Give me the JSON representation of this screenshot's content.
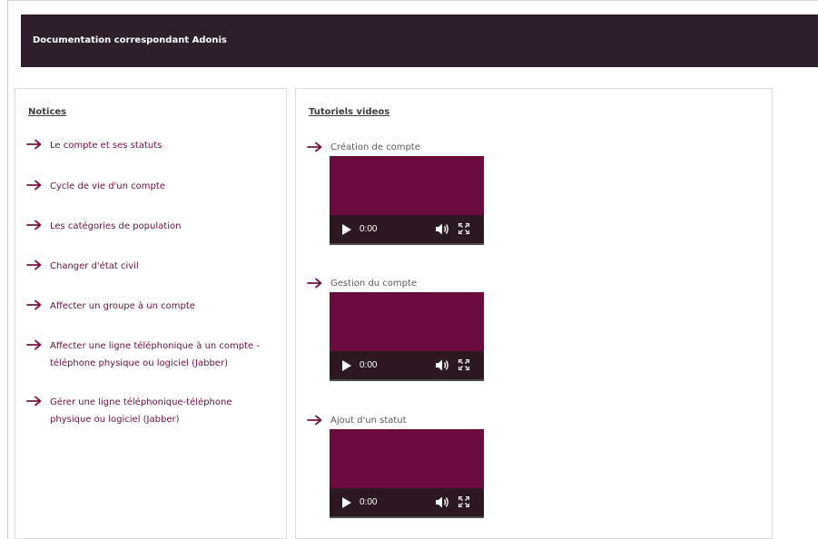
{
  "banner": {
    "title": "Documentation correspondant Adonis"
  },
  "notices": {
    "heading": "Notices",
    "items": [
      {
        "label": "Le compte et ses statuts"
      },
      {
        "label": "Cycle de vie d'un compte"
      },
      {
        "label": "Les catégories de population"
      },
      {
        "label": "Changer d'état civil"
      },
      {
        "label": "Affecter un groupe à un compte"
      },
      {
        "label": "Affecter une ligne téléphonique à un compte -\ntéléphone physique ou logiciel (Jabber)"
      },
      {
        "label": "Gérer une ligne téléphonique-téléphone\nphysique ou logiciel (Jabber)"
      }
    ]
  },
  "videos": {
    "heading": "Tutoriels videos",
    "items": [
      {
        "label": "Création de compte",
        "time": "0:00"
      },
      {
        "label": "Gestion du compte",
        "time": "0:00"
      },
      {
        "label": "Ajout d'un statut",
        "time": "0:00"
      }
    ]
  },
  "colors": {
    "banner_bg": "#2e1f2f",
    "link": "#6b0f3f",
    "video_bg": "#6b0a3c",
    "controls_bg": "#2b1820"
  },
  "icons": {
    "arrow": "arrow-right-icon",
    "play": "play-icon",
    "volume": "volume-icon",
    "fullscreen": "fullscreen-icon"
  }
}
